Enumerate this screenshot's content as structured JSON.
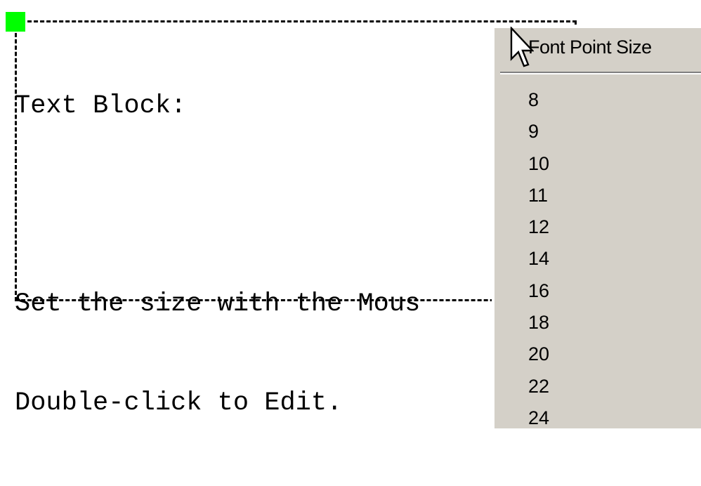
{
  "text_block": {
    "lines": [
      "Text Block:",
      "",
      "Set the size with the Mous",
      "Double-click to Edit."
    ]
  },
  "context_menu": {
    "title": "Font Point Size",
    "items": [
      "8",
      "9",
      "10",
      "11",
      "12",
      "14",
      "16",
      "18",
      "20",
      "22",
      "24"
    ]
  },
  "colors": {
    "handle": "#00ff00",
    "menu_bg": "#d4d0c8"
  },
  "icons": {
    "cursor": "arrow-cursor-icon",
    "handle": "resize-handle-icon"
  }
}
